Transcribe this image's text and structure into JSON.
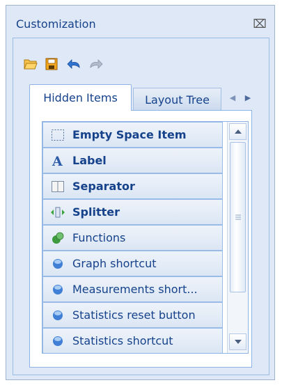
{
  "window": {
    "title": "Customization",
    "close_icon": "close-icon"
  },
  "toolbar": {
    "buttons": [
      {
        "name": "open-folder-icon",
        "color": "#f0a030"
      },
      {
        "name": "save-icon",
        "color": "#e08a10"
      },
      {
        "name": "undo-icon",
        "color": "#2b6cc4"
      },
      {
        "name": "redo-icon",
        "color": "#9aa7b8"
      }
    ]
  },
  "tabs": [
    {
      "label": "Hidden Items",
      "active": true
    },
    {
      "label": "Layout Tree",
      "active": false
    }
  ],
  "items": [
    {
      "label": "Empty Space Item",
      "bold": true,
      "icon": "empty-space-icon"
    },
    {
      "label": "Label",
      "bold": true,
      "icon": "label-icon"
    },
    {
      "label": "Separator",
      "bold": true,
      "icon": "separator-icon"
    },
    {
      "label": "Splitter",
      "bold": true,
      "icon": "splitter-icon"
    },
    {
      "label": "Functions",
      "bold": false,
      "icon": "functions-icon"
    },
    {
      "label": "Graph shortcut",
      "bold": false,
      "icon": "item-ball-icon"
    },
    {
      "label": "Measurements short...",
      "bold": false,
      "icon": "item-ball-icon"
    },
    {
      "label": "Statistics reset button",
      "bold": false,
      "icon": "item-ball-icon"
    },
    {
      "label": "Statistics shortcut",
      "bold": false,
      "icon": "item-ball-icon"
    }
  ],
  "colors": {
    "accent_text": "#15428b",
    "border": "#99bbe8",
    "panel_bg": "#dfe8f6"
  }
}
